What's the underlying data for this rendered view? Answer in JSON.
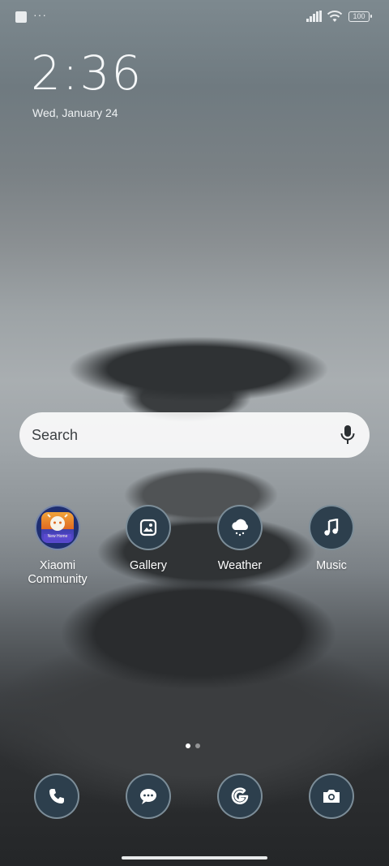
{
  "status_bar": {
    "more_indicator": "···",
    "battery_level": "100",
    "icons": [
      "notification-square-icon",
      "signal-icon",
      "wifi-icon",
      "battery-icon"
    ]
  },
  "lockscreen": {
    "time": "2:36",
    "date": "Wed, January 24"
  },
  "search": {
    "placeholder": "Search",
    "icon": "mic-icon"
  },
  "apps": [
    {
      "label_line1": "Xiaomi",
      "label_line2": "Community",
      "icon": "xiaomi-community-icon"
    },
    {
      "label": "Gallery",
      "icon": "gallery-icon"
    },
    {
      "label": "Weather",
      "icon": "weather-icon"
    },
    {
      "label": "Music",
      "icon": "music-icon"
    }
  ],
  "community_badge_text": "New Home",
  "page_indicator": {
    "pages": 2,
    "current": 1
  },
  "dock": [
    {
      "icon": "phone-icon"
    },
    {
      "icon": "messages-icon"
    },
    {
      "icon": "google-icon"
    },
    {
      "icon": "camera-icon"
    }
  ],
  "colors": {
    "icon_bg": "#2d3f4d",
    "search_bg": "#ffffff",
    "text": "#ffffff"
  }
}
